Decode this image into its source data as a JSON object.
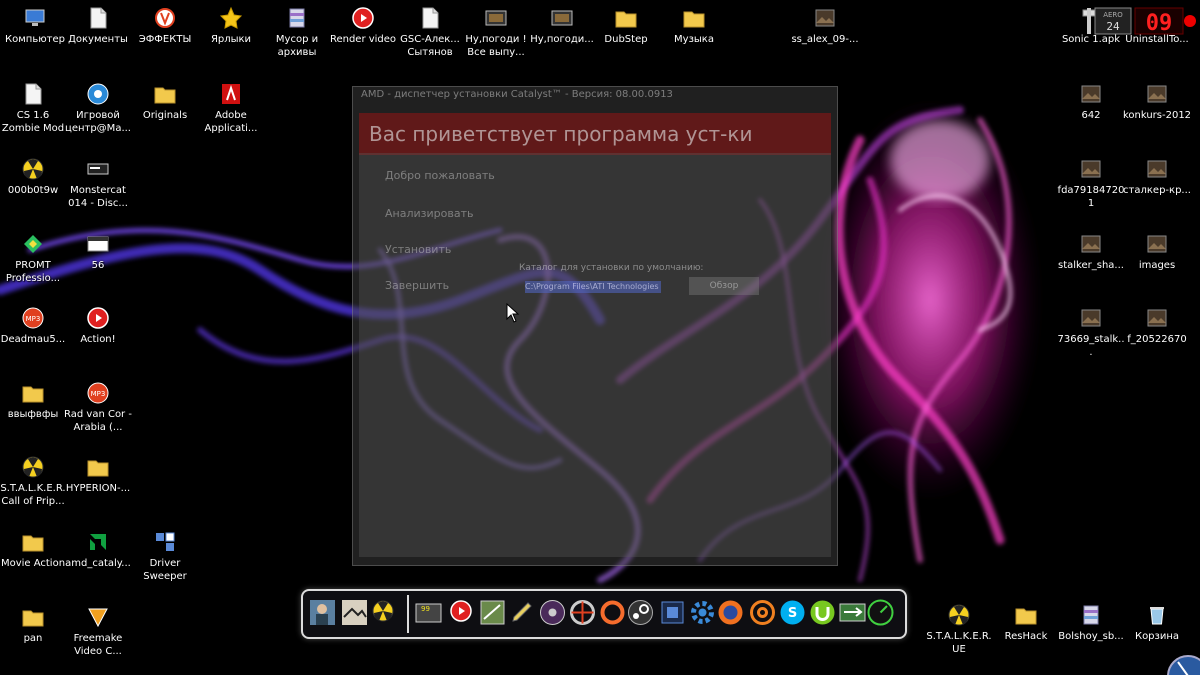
{
  "desktop": {
    "icons": [
      {
        "id": "computer",
        "label": "Компьютер",
        "icon": "computer-icon"
      },
      {
        "id": "documents",
        "label": "Документы",
        "icon": "document-icon"
      },
      {
        "id": "effects",
        "label": "ЭФФЕКТЫ",
        "icon": "effects-icon"
      },
      {
        "id": "shortcuts",
        "label": "Ярлыки",
        "icon": "star-icon"
      },
      {
        "id": "trash-archives",
        "label": "Мусор и архивы",
        "icon": "archive-icon"
      },
      {
        "id": "render-video",
        "label": "Render video",
        "icon": "record-icon"
      },
      {
        "id": "gsc",
        "label": "GSC-Алек... Сытянов",
        "icon": "document-icon"
      },
      {
        "id": "nu-pogodi-1",
        "label": "Ну,погоди ! Все выпу...",
        "icon": "video-icon"
      },
      {
        "id": "nu-pogodi-2",
        "label": "Ну,погоди...",
        "icon": "video-icon"
      },
      {
        "id": "dubstep",
        "label": "DubStep",
        "icon": "folder-icon"
      },
      {
        "id": "music",
        "label": "Музыка",
        "icon": "folder-icon"
      },
      {
        "id": "ss-alex",
        "label": "ss_alex_09-...",
        "icon": "image-icon"
      },
      {
        "id": "sonic",
        "label": "Sonic 1.apk",
        "icon": "apk-icon"
      },
      {
        "id": "uninstall",
        "label": "UninstallTo...",
        "icon": "app-icon"
      },
      {
        "id": "cs16",
        "label": "CS 1.6 Zombie Mod",
        "icon": "document-icon"
      },
      {
        "id": "game-center",
        "label": "Игровой центр@Ma...",
        "icon": "game-center-icon"
      },
      {
        "id": "originals",
        "label": "Originals",
        "icon": "folder-icon"
      },
      {
        "id": "adobe",
        "label": "Adobe Applicati...",
        "icon": "adobe-icon"
      },
      {
        "id": "642",
        "label": "642",
        "icon": "image-icon"
      },
      {
        "id": "konkurs",
        "label": "konkurs-2012",
        "icon": "image-icon"
      },
      {
        "id": "000b0t9w",
        "label": "000b0t9w",
        "icon": "radiation-icon"
      },
      {
        "id": "monstercat",
        "label": "Monstercat 014 - Disc...",
        "icon": "audio-icon"
      },
      {
        "id": "fda",
        "label": "fda791847201",
        "icon": "image-icon"
      },
      {
        "id": "stalker-kr",
        "label": "сталкер-кр...",
        "icon": "image-icon"
      },
      {
        "id": "promt",
        "label": "PROMT Professio...",
        "icon": "promt-icon"
      },
      {
        "id": "56",
        "label": "56",
        "icon": "window-icon"
      },
      {
        "id": "stalker-sha",
        "label": "stalker_sha...",
        "icon": "image-icon"
      },
      {
        "id": "images",
        "label": "images",
        "icon": "image-icon"
      },
      {
        "id": "deadmau5",
        "label": "Deadmau5...",
        "icon": "mp3-icon"
      },
      {
        "id": "action",
        "label": "Action!",
        "icon": "record-icon"
      },
      {
        "id": "73669",
        "label": "73669_stalk...",
        "icon": "image-icon"
      },
      {
        "id": "f20522670",
        "label": "f_20522670",
        "icon": "image-icon"
      },
      {
        "id": "vvyfvfy",
        "label": "ввыфвфы",
        "icon": "folder-icon"
      },
      {
        "id": "rad-van-cor",
        "label": "Rad van Cor - Arabia (...",
        "icon": "mp3-icon"
      },
      {
        "id": "stalker-cop",
        "label": "S.T.A.L.K.E.R. Call of Prip...",
        "icon": "radiation-icon"
      },
      {
        "id": "hyperion",
        "label": "HYPERION-...",
        "icon": "folder-icon"
      },
      {
        "id": "movie-action",
        "label": "Movie Action",
        "icon": "folder-icon"
      },
      {
        "id": "amd-catalyst",
        "label": "amd_cataly...",
        "icon": "amd-icon"
      },
      {
        "id": "driver-sweeper",
        "label": "Driver Sweeper",
        "icon": "sweeper-icon"
      },
      {
        "id": "pan",
        "label": "pan",
        "icon": "folder-icon"
      },
      {
        "id": "freemake",
        "label": "Freemake Video C...",
        "icon": "freemake-icon"
      },
      {
        "id": "stalker-ue",
        "label": "S.T.A.L.K.E.R. UE",
        "icon": "radiation-icon"
      },
      {
        "id": "reshack",
        "label": "ResHack",
        "icon": "folder-icon"
      },
      {
        "id": "bolshoy",
        "label": "Bolshoy_sb...",
        "icon": "archive-icon"
      },
      {
        "id": "recycle-bin",
        "label": "Корзина",
        "icon": "recycle-bin-icon"
      }
    ]
  },
  "ghost_window": {
    "title": "AMD - диспетчер установки Catalyst™ - Версия: 08.00.0913",
    "banner": "Вас приветствует программа уст-ки",
    "steps": [
      "Добро пожаловать",
      "Анализировать",
      "Установить",
      "Завершить"
    ],
    "path_label": "Каталог для установки по умолчанию:",
    "path_value": "C:\\Program Files\\ATI Technologies",
    "browse_label": "Обзор"
  },
  "aero_widget": {
    "fps": "24",
    "counter": "09",
    "brand": "AERO"
  },
  "dock": {
    "items": [
      {
        "id": "soldier",
        "icon": "soldier-icon"
      },
      {
        "id": "stalker-art",
        "icon": "game-art-icon"
      },
      {
        "id": "radiation",
        "icon": "radiation-icon"
      },
      {
        "id": "fraps",
        "icon": "fraps-icon"
      },
      {
        "id": "action",
        "icon": "record-icon"
      },
      {
        "id": "box",
        "icon": "box-icon"
      },
      {
        "id": "pencil",
        "icon": "pencil-icon"
      },
      {
        "id": "film",
        "icon": "film-icon"
      },
      {
        "id": "photoscape",
        "icon": "photoscape-icon"
      },
      {
        "id": "origin",
        "icon": "origin-icon"
      },
      {
        "id": "steam",
        "icon": "steam-icon"
      },
      {
        "id": "puzzle",
        "icon": "puzzle-icon"
      },
      {
        "id": "settings",
        "icon": "gear-icon"
      },
      {
        "id": "firefox",
        "icon": "firefox-icon"
      },
      {
        "id": "mail",
        "icon": "at-icon"
      },
      {
        "id": "skype",
        "icon": "skype-icon"
      },
      {
        "id": "utorrent",
        "icon": "utorrent-icon"
      },
      {
        "id": "switcher",
        "icon": "switch-icon"
      },
      {
        "id": "speedometer",
        "icon": "speedometer-icon"
      }
    ]
  },
  "colors": {
    "background": "#000000",
    "smoke_pink": "#ff2cc8",
    "smoke_violet": "#6a3cff",
    "dock_border": "#dcdcdc"
  }
}
